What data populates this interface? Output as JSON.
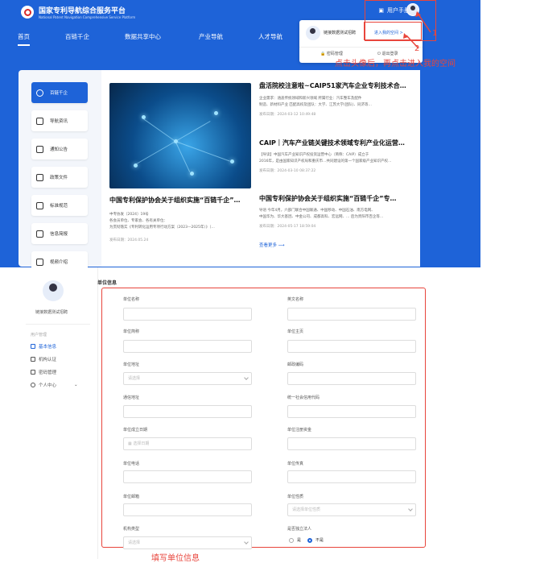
{
  "header": {
    "site_title": "国家专利导航综合服务平台",
    "site_subtitle": "National Patent Navigation Comprehensive Service Platform",
    "user_manual": "用户手册"
  },
  "nav": [
    "首页",
    "百链千企",
    "数据共享中心",
    "产业导航",
    "人才导航"
  ],
  "popup": {
    "user_name": "链接数据测试招聘",
    "enter_space": "进入我的空间 >",
    "btn_password": "密码管理",
    "btn_logout": "退出登录"
  },
  "annotations": {
    "num1": "1",
    "num2": "2",
    "instruction": "点击头像后，再点击进入我的空间",
    "caption": "填写单位信息"
  },
  "sidebar": [
    {
      "label": "百链千企",
      "icon": "link-icon"
    },
    {
      "label": "导航资讯",
      "icon": "news-icon"
    },
    {
      "label": "通知公告",
      "icon": "notice-icon"
    },
    {
      "label": "政策文件",
      "icon": "policy-icon"
    },
    {
      "label": "标准规范",
      "icon": "standard-icon"
    },
    {
      "label": "信息简报",
      "icon": "brief-icon"
    },
    {
      "label": "视频介绍",
      "icon": "video-icon"
    }
  ],
  "articles": {
    "main": {
      "title": "中国专利保护协会关于组织实施“百链千企”…",
      "lines": [
        "中专协发〔2024〕19号",
        "各会员单位、专家会、各有关单位：",
        "为贯彻落实《专利转化运用专项行动方案（2023—2025年）》（…"
      ],
      "date": "发布日期：2024.05.24"
    },
    "list": [
      {
        "title": "盘活院校注意啦~CAIP51家汽车企业专利技术合…",
        "lines": [
          "企业需求：涵盖传统领域和新兴领域 所属行业：汽车整车及配件",
          "制造、新材料产业 匹配高校及团队：大学、江苏大学(团队)、同济等…"
        ],
        "date": "发布日期：2024-03-12 10:49:48"
      },
      {
        "title": "CAIP｜汽车产业链关键技术领域专利产业化运营…",
        "lines": [
          "【导读】中国汽车产业知识产权投资运营中心（简称：CAIP）成立于",
          "2016年，是由国家知识产权局和重庆市…共同建设的第一个国家级产业知识产权…"
        ],
        "date": "发布日期：2024-03-10 08:37:22"
      },
      {
        "title": "中国专利保护协会关于组织实施“百链千企”专…",
        "lines": [
          "导语 今年4月，六部门联合中国联通、中国移动、中国石油、南方电网、",
          "中国华为、华大基因、中金公司、成都高科、宏远网、… 后为贵阳市百企等…"
        ],
        "date": "发布日期：2024-05-17 18:59:04"
      }
    ],
    "more": "查看更多 ⟶"
  },
  "profile": {
    "name": "链接数据测试招聘",
    "menu_header": "用户管理",
    "menu": [
      "基本信息",
      "机构认证",
      "密码管理",
      "个人中心"
    ]
  },
  "form": {
    "section_title": "单位信息",
    "fields": {
      "unit_name": "单位名称",
      "english_name": "英文名称",
      "unit_short": "单位简称",
      "homepage": "单位主页",
      "unit_address": "单位地址",
      "region_placeholder": "请选择",
      "postcode": "邮政编码",
      "mail_address": "通信地址",
      "credit_code": "统一社会信用代码",
      "found_date": "单位成立日期",
      "date_placeholder": "选择日期",
      "reg_capital": "单位注册资金",
      "phone": "单位电话",
      "fax": "单位传真",
      "email": "单位邮箱",
      "nature": "单位性质",
      "nature_placeholder": "请选择单位性质",
      "org_type": "机构类型",
      "org_placeholder": "请选择",
      "independent": "是否独立法人",
      "yes": "是",
      "no": "不是"
    }
  },
  "colors": {
    "primary": "#1e63d8",
    "annotation": "#e8453c"
  }
}
